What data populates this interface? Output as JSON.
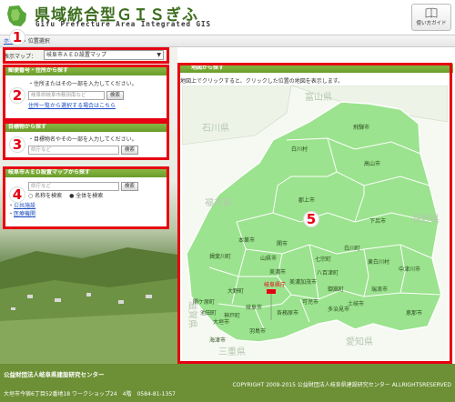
{
  "header": {
    "title": "県域統合型ＧＩＳぎふ",
    "subtitle": "Gifu Prefecture Area Integrated GIS",
    "guide_label": "使い方ガイド"
  },
  "breadcrumb": {
    "home": "ホーム",
    "sep": ">",
    "current": "位置選択"
  },
  "map_select": {
    "label": "表示マップ：",
    "value": "岐阜市ＡＥＤ設置マップ"
  },
  "panels": {
    "postal": {
      "title": "郵便番号・住所から探す",
      "desc": "・住所またはその一部を入力してください。",
      "placeholder": "岐阜県岐阜市薮田南など",
      "search": "検索",
      "link": "住所一覧から選択する場合はこちら"
    },
    "landmark": {
      "title": "目標物から探す",
      "desc": "・目標物名やその一部を入力してください。",
      "placeholder": "県庁など",
      "search": "検索"
    },
    "aed": {
      "title": "岐阜市ＡＥＤ設置マップから探す",
      "placeholder": "県庁など",
      "search": "検索",
      "opt_name": "名称を検索",
      "opt_all": "全体を検索",
      "link1": "公共施設",
      "link2": "医療機関"
    }
  },
  "map": {
    "title": "地図から探す",
    "instruction": "地図上でクリックすると、クリックした位置の地図を表示します。",
    "selected": "岐阜県庁",
    "prefectures": [
      "富山県",
      "石川県",
      "福井県",
      "長野県",
      "滋賀県",
      "愛知県",
      "三重県"
    ],
    "cities": [
      "飛騨市",
      "白川村",
      "高山市",
      "郡上市",
      "下呂市",
      "関市",
      "美濃市",
      "美濃加茂市",
      "七宗町",
      "中津川市",
      "恵那市",
      "白川町",
      "東白川村",
      "八百津町",
      "御嵩町",
      "瑞浪市",
      "土岐市",
      "多治見市",
      "可児市",
      "本巣市",
      "揖斐川町",
      "山県市",
      "大垣市",
      "岐阜市",
      "各務原市",
      "羽島市",
      "海津市",
      "関ケ原町",
      "大野町",
      "池田町",
      "神戸町",
      "坂祝町",
      "富加町",
      "川辺町",
      "笠松町",
      "岐南町",
      "瑞穂市"
    ]
  },
  "callouts": [
    "1",
    "2",
    "3",
    "4",
    "5"
  ],
  "footer": {
    "org": "公益財団法人岐阜県建設研究センター",
    "address": "大垣市今宿6丁目52番地18 ワークショップ24　4階　0584-81-1357",
    "copyright": "COPYRIGHT 2009-2015 公益財団法人岐阜県建設研究センター ALLRIGHTSRESERVED"
  },
  "colors": {
    "accent": "#6d8f35",
    "highlight": "#e60012",
    "map_land": "#9be38e",
    "link": "#1a4cc2"
  }
}
